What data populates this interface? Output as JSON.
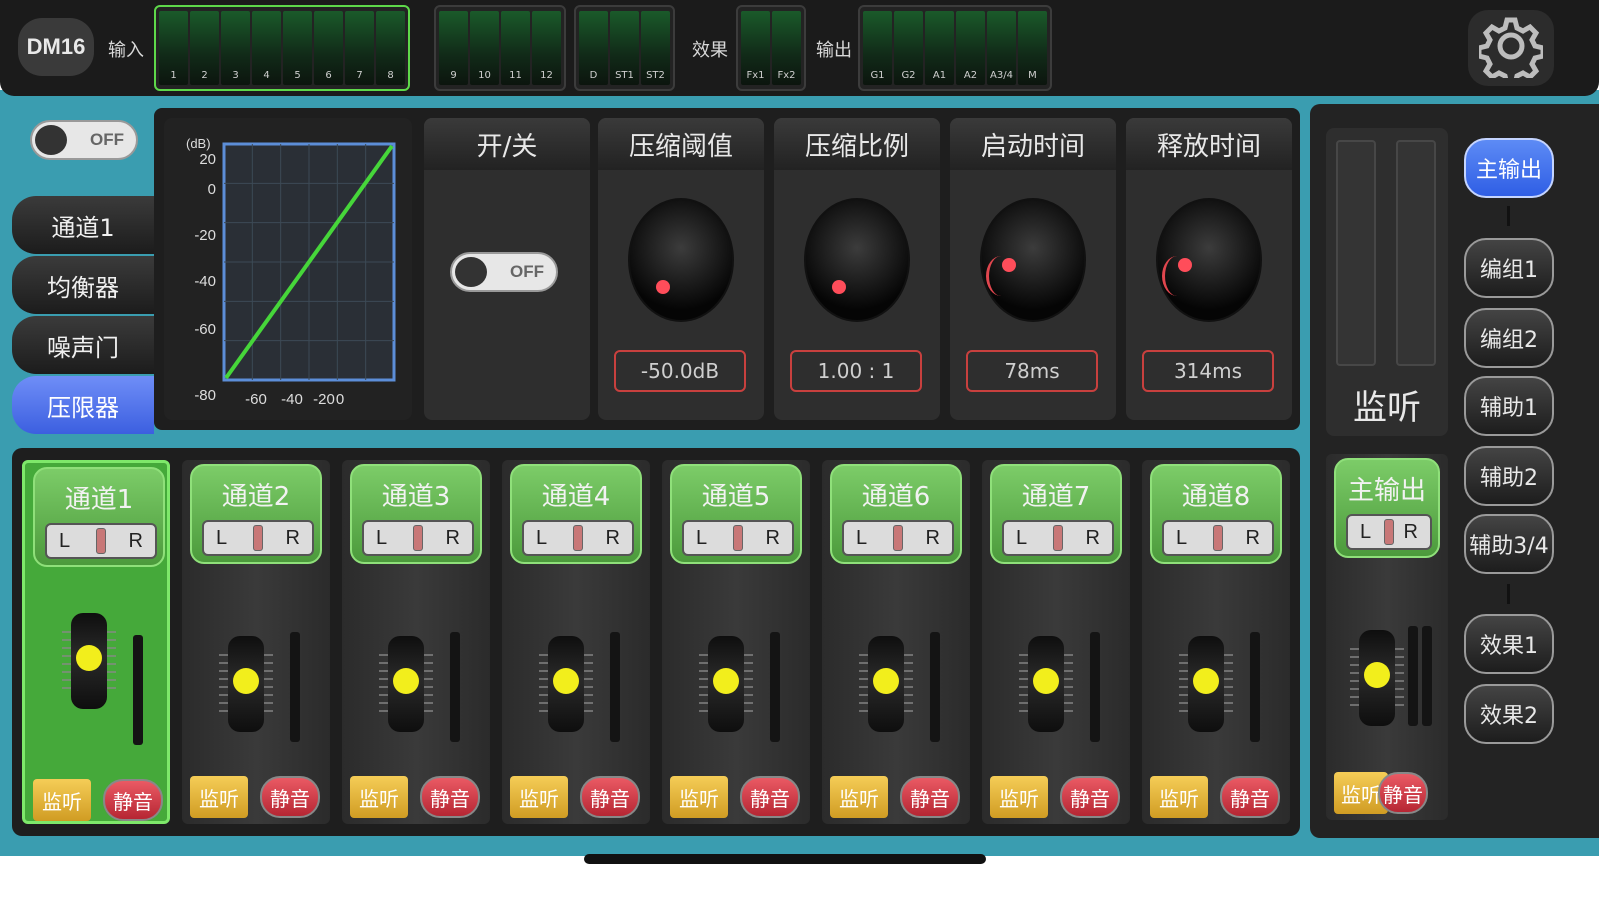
{
  "topbar": {
    "brand": "DM16",
    "input_label": "输入",
    "effects_label": "效果",
    "output_label": "输出",
    "meter_groups": [
      {
        "channels": [
          "1",
          "2",
          "3",
          "4",
          "5",
          "6",
          "7",
          "8"
        ],
        "active": true
      },
      {
        "channels": [
          "9",
          "10",
          "11",
          "12"
        ],
        "active": false
      },
      {
        "channels": [
          "D",
          "ST1",
          "ST2"
        ],
        "active": false
      },
      {
        "channels": [
          "Fx1",
          "Fx2"
        ],
        "active": false
      },
      {
        "channels": [
          "G1",
          "G2",
          "A1",
          "A2",
          "A3/4",
          "M"
        ],
        "active": false
      }
    ],
    "settings_icon": "gear-icon"
  },
  "nav": {
    "power_switch": "OFF",
    "items": [
      "通道1",
      "均衡器",
      "噪声门",
      "压限器"
    ],
    "active_index": 3
  },
  "compressor": {
    "graph_unit": "(dB)",
    "graph_y_ticks": [
      "20",
      "0",
      "-20",
      "-40",
      "-60",
      "-80"
    ],
    "graph_x_ticks": [
      "-60",
      "-40",
      "-20",
      "0"
    ],
    "switch_header": "开/关",
    "switch_state": "OFF",
    "params": [
      {
        "header": "压缩阈值",
        "value": "-50.0dB"
      },
      {
        "header": "压缩比例",
        "value": "1.00 : 1"
      },
      {
        "header": "启动时间",
        "value": "78ms"
      },
      {
        "header": "释放时间",
        "value": "314ms"
      }
    ]
  },
  "strips": [
    {
      "name": "通道1",
      "pan_left": "L",
      "pan_right": "R",
      "monitor": "监听",
      "mute": "静音",
      "active": true
    },
    {
      "name": "通道2",
      "pan_left": "L",
      "pan_right": "R",
      "monitor": "监听",
      "mute": "静音",
      "active": false
    },
    {
      "name": "通道3",
      "pan_left": "L",
      "pan_right": "R",
      "monitor": "监听",
      "mute": "静音",
      "active": false
    },
    {
      "name": "通道4",
      "pan_left": "L",
      "pan_right": "R",
      "monitor": "监听",
      "mute": "静音",
      "active": false
    },
    {
      "name": "通道5",
      "pan_left": "L",
      "pan_right": "R",
      "monitor": "监听",
      "mute": "静音",
      "active": false
    },
    {
      "name": "通道6",
      "pan_left": "L",
      "pan_right": "R",
      "monitor": "监听",
      "mute": "静音",
      "active": false
    },
    {
      "name": "通道7",
      "pan_left": "L",
      "pan_right": "R",
      "monitor": "监听",
      "mute": "静音",
      "active": false
    },
    {
      "name": "通道8",
      "pan_left": "L",
      "pan_right": "R",
      "monitor": "监听",
      "mute": "静音",
      "active": false
    }
  ],
  "master": {
    "name": "主输出",
    "pan_left": "L",
    "pan_right": "R",
    "monitor": "监听",
    "mute": "静音"
  },
  "monitor_panel": {
    "label": "监听"
  },
  "bus_buttons": [
    "主输出",
    "编组1",
    "编组2",
    "辅助1",
    "辅助2",
    "辅助3/4",
    "效果1",
    "效果2"
  ],
  "bus_active_index": 0,
  "colors": {
    "accent_blue": "#3c5fe0",
    "channel_green": "#4c9a3c",
    "meter_active": "#5ed84a",
    "mute_red": "#b62633",
    "monitor_yellow": "#d09c23",
    "background_teal": "#3a9db0"
  }
}
